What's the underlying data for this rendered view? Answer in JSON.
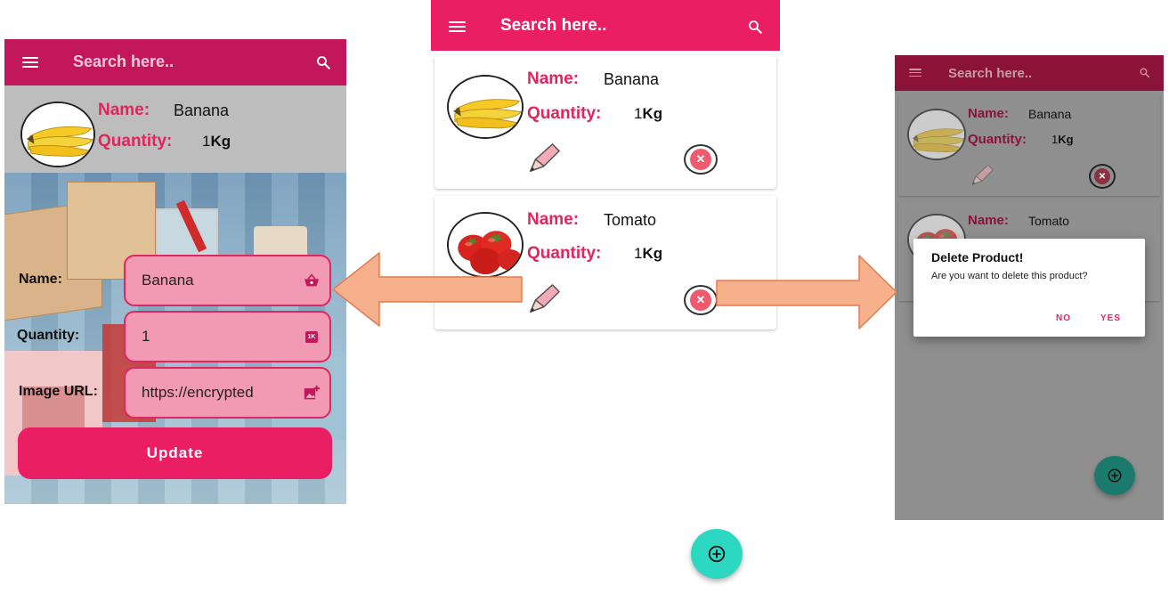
{
  "colors": {
    "primary": "#e91e63",
    "accent_label": "#e0255f",
    "fab": "#2dd8c2",
    "arrow_fill": "#f6b08c",
    "arrow_stroke": "#e37a4d"
  },
  "appbar": {
    "search_placeholder": "Search here.."
  },
  "labels": {
    "name": "Name:",
    "quantity": "Quantity:"
  },
  "products": [
    {
      "name": "Banana",
      "quantity": "1",
      "unit": "Kg",
      "image": "banana-image"
    },
    {
      "name": "Tomato",
      "quantity": "1",
      "unit": "Kg",
      "image": "tomato-image"
    }
  ],
  "edit_form": {
    "name_label": "Name:",
    "quantity_label": "Quantity:",
    "image_url_label": "Image URL:",
    "name_value": "Banana",
    "quantity_value": "1",
    "image_url_value": "https://encrypted",
    "quantity_icon_text": "1K",
    "update_label": "Update"
  },
  "dialog": {
    "title": "Delete Product!",
    "message": "Are you want to delete this product?",
    "no_label": "NO",
    "yes_label": "YES"
  },
  "icons": {
    "menu": "menu-icon",
    "search": "search-icon",
    "edit": "pencil-icon",
    "delete": "close-circle-icon",
    "add": "add-circle-icon",
    "basket": "basket-icon",
    "image_add": "image-add-icon"
  }
}
